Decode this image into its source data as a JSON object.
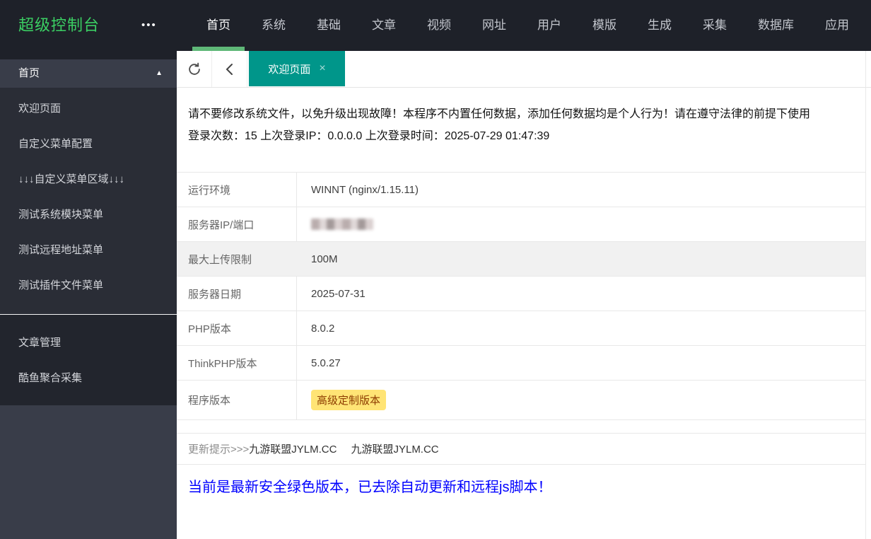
{
  "navbar": {
    "logo": "超级控制台",
    "menu_toggle_icon": "•••",
    "active_index": 0,
    "items": [
      "首页",
      "系统",
      "基础",
      "文章",
      "视频",
      "网址",
      "用户",
      "模版",
      "生成",
      "采集",
      "数据库",
      "应用"
    ]
  },
  "sidebar": {
    "group_title": "首页",
    "collapse_icon": "▲",
    "items": [
      "欢迎页面",
      "自定义菜单配置",
      "↓↓↓自定义菜单区域↓↓↓",
      "测试系统模块菜单",
      "测试远程地址菜单",
      "测试插件文件菜单"
    ],
    "secondary_items": [
      "文章管理",
      "酷鱼聚合采集"
    ]
  },
  "tabbar": {
    "active_tab": "欢迎页面",
    "close_icon": "×"
  },
  "notice": {
    "line1": "请不要修改系统文件，以免升级出现故障！本程序不内置任何数据，添加任何数据均是个人行为！请在遵守法律的前提下使用",
    "line2": "登录次数：15 上次登录IP：0.0.0.0 上次登录时间：2025-07-29 01:47:39"
  },
  "info_table": {
    "rows": [
      {
        "label": "运行环境",
        "value": "WINNT (nginx/1.15.11)"
      },
      {
        "label": "服务器IP/端口",
        "value": "",
        "masked": true
      },
      {
        "label": "最大上传限制",
        "value": "100M",
        "shaded": true
      },
      {
        "label": "服务器日期",
        "value": "2025-07-31"
      },
      {
        "label": "PHP版本",
        "value": "8.0.2"
      },
      {
        "label": "ThinkPHP版本",
        "value": "5.0.27"
      },
      {
        "label": "程序版本",
        "value": "高级定制版本",
        "badge": true,
        "last": true
      }
    ]
  },
  "update_box": {
    "prefix": "更新提示>>>",
    "link1": "九游联盟JYLM.CC",
    "link2": "九游联盟JYLM.CC"
  },
  "footer_note": "当前是最新安全绿色版本，已去除自动更新和远程js脚本！",
  "colors": {
    "navbar_bg": "#1e2129",
    "logo_green": "#3bcf63",
    "accent_green": "#5FB878",
    "tab_teal": "#00968a",
    "sidebar_bg": "#393d49",
    "submenu_bg": "#2a2d36",
    "badge_bg": "#ffe475",
    "badge_text": "#8d3c00",
    "note_blue": "#0000ff",
    "row_shaded": "#f1f1f1"
  }
}
